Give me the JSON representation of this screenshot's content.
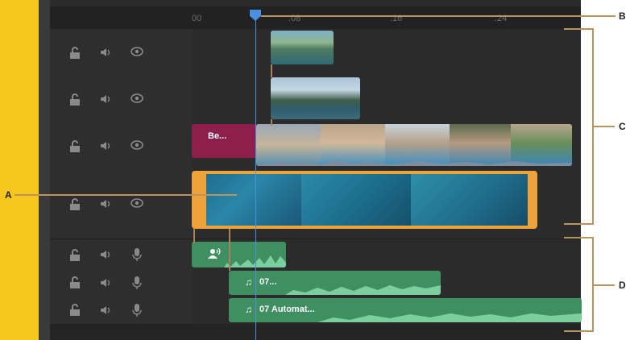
{
  "ruler": {
    "ticks": [
      "00",
      ".08",
      ".16",
      ".24"
    ]
  },
  "tracks": {
    "video": [
      {
        "name": "video-track-4"
      },
      {
        "name": "video-track-3"
      },
      {
        "name": "video-track-2"
      },
      {
        "name": "video-track-1"
      }
    ],
    "audio": [
      {
        "name": "audio-track-1"
      },
      {
        "name": "audio-track-2"
      },
      {
        "name": "audio-track-3"
      }
    ]
  },
  "clips": {
    "title_clip_label": "Be...",
    "narration_label": "",
    "music_clip_1_label": "07...",
    "music_clip_2_label": "07 Automat..."
  },
  "icons": {
    "lock": "lock-icon",
    "speaker": "speaker-icon",
    "eye": "eye-icon",
    "mic": "microphone-icon",
    "music": "music-note-icon",
    "voice": "voiceover-icon"
  },
  "colors": {
    "selection": "#f0a23a",
    "audio_clip": "#3f8f63",
    "title_clip": "#8e1f4c",
    "playhead": "#4a8fe0",
    "callout": "#b9955b",
    "sidebar": "#f7c61f"
  },
  "callouts": {
    "a": "A",
    "b": "B",
    "c": "C",
    "d": "D"
  }
}
